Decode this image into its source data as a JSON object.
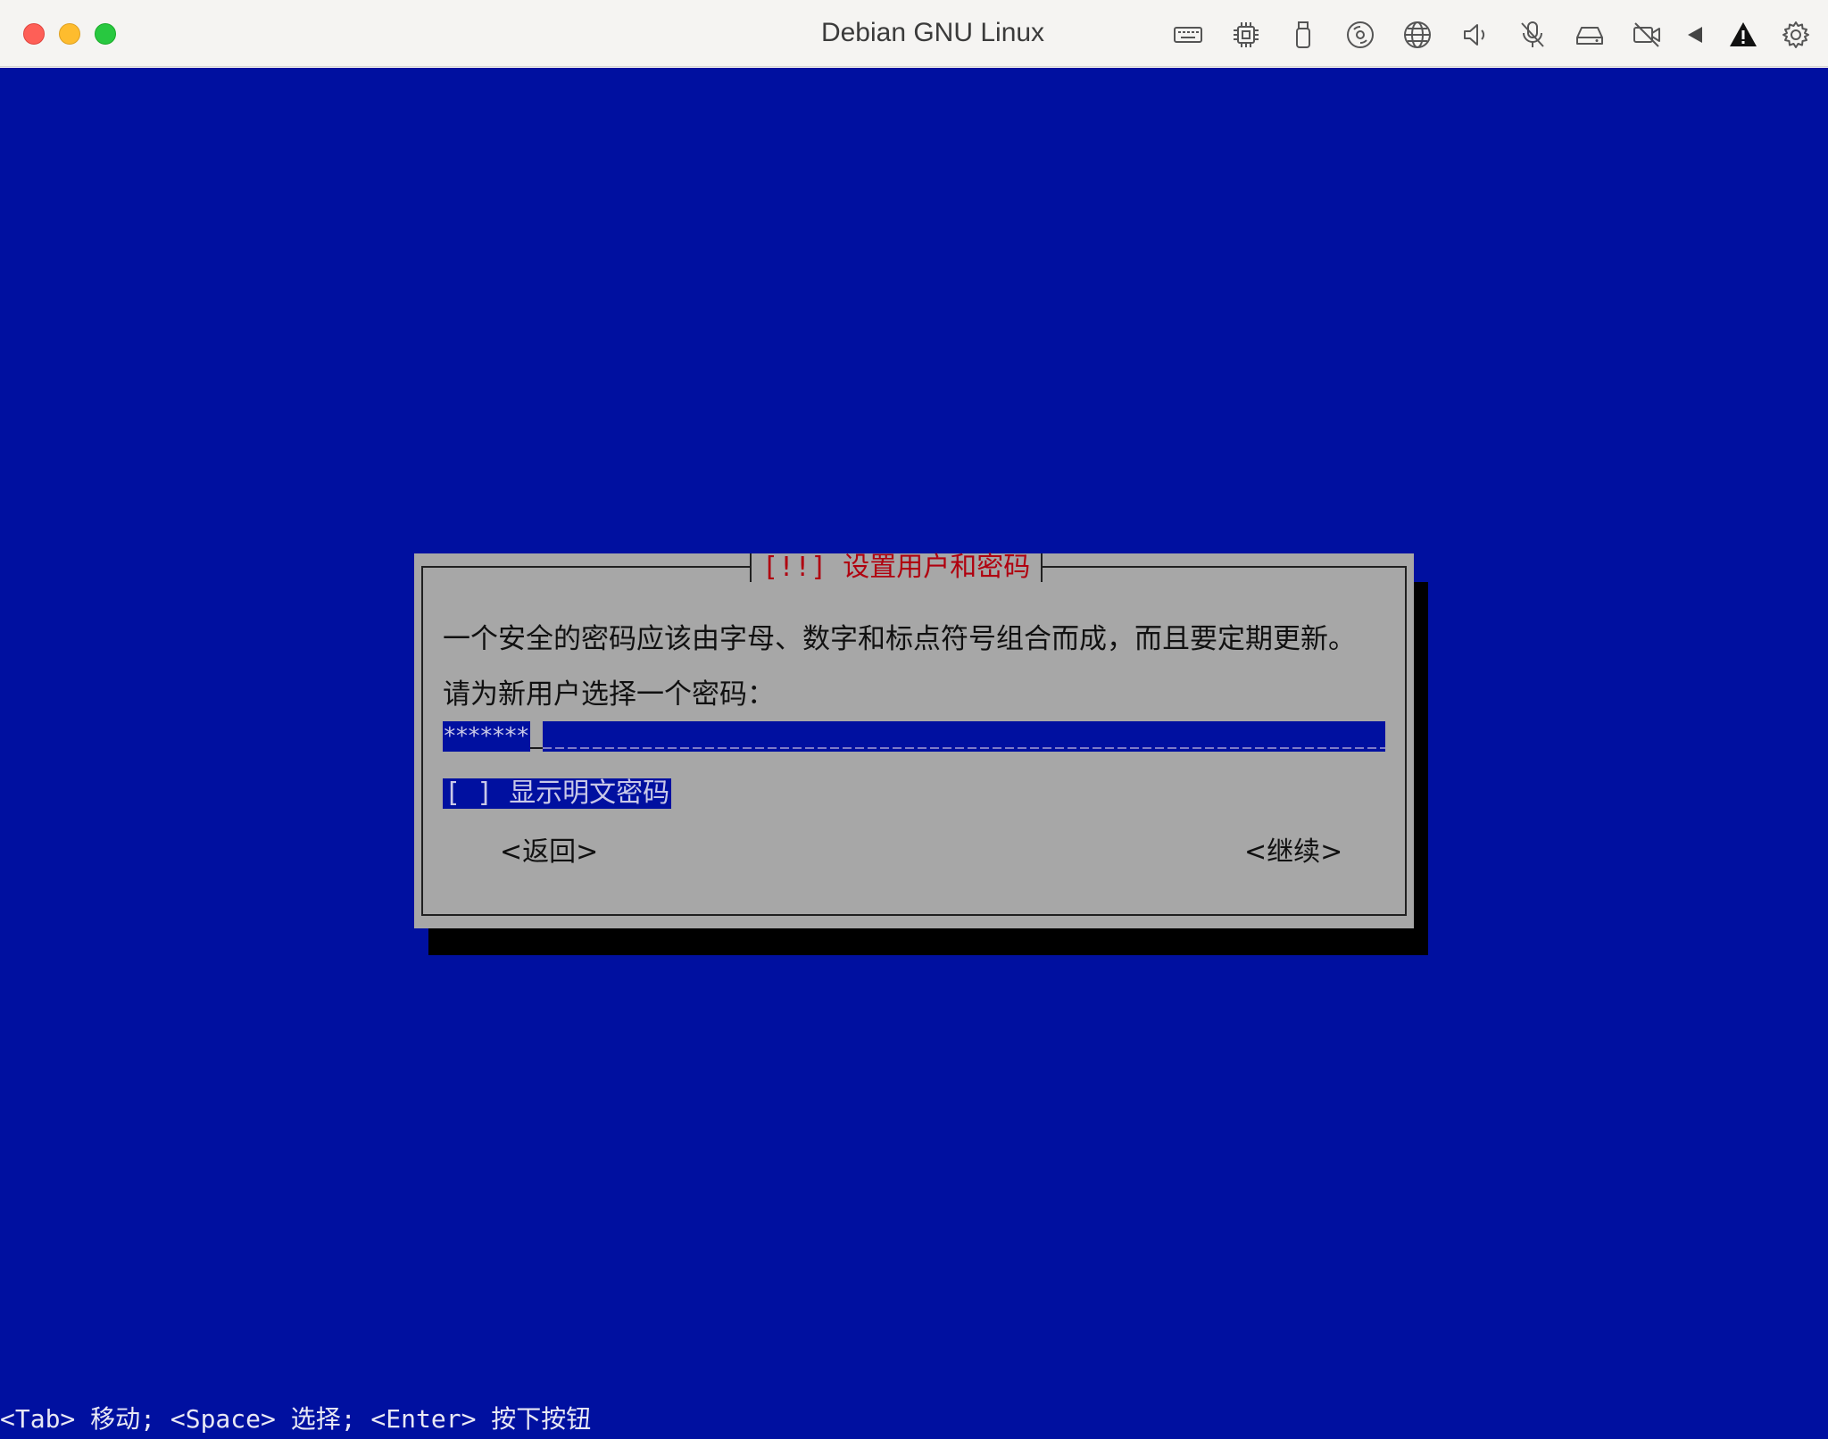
{
  "window": {
    "title": "Debian GNU Linux"
  },
  "toolbar_icons": [
    "keyboard-icon",
    "cpu-icon",
    "usb-icon",
    "disc-icon",
    "network-icon",
    "speaker-icon",
    "microphone-muted-icon",
    "drive-icon",
    "camera-off-icon",
    "back-icon",
    "warning-icon",
    "gear-icon"
  ],
  "dialog": {
    "title": "[!!] 设置用户和密码",
    "message": "一个安全的密码应该由字母、数字和标点符号组合而成，而且要定期更新。",
    "prompt": "请为新用户选择一个密码：",
    "password_mask": "*******",
    "show_password_box": "[ ]",
    "show_password_label": "显示明文密码",
    "back_button": "<返回>",
    "continue_button": "<继续>"
  },
  "footer": {
    "hint": "<Tab> 移动; <Space> 选择; <Enter> 按下按钮"
  },
  "colors": {
    "screen_background": "#0010a0",
    "dialog_background": "#a7a7a7",
    "dialog_title": "#b0000f"
  }
}
